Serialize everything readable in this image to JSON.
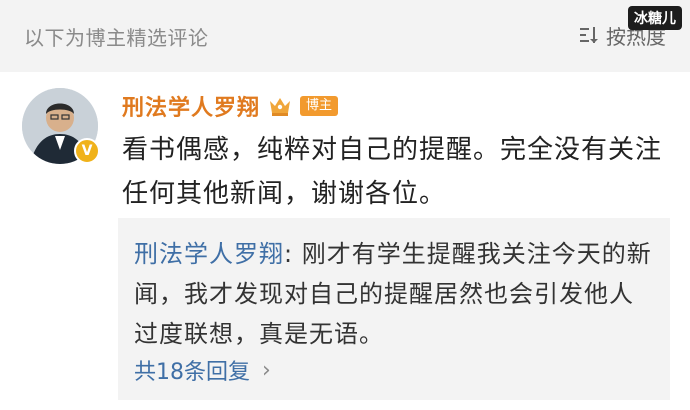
{
  "header": {
    "section_title": "以下为博主精选评论",
    "sort_label": "按热度",
    "watermark": "冰糖儿"
  },
  "comment": {
    "username": "刑法学人罗翔",
    "role_badge": "博主",
    "verified_badge": "V",
    "text": "看书偶感，纯粹对自己的提醒。完全没有关注任何其他新闻，谢谢各位。",
    "reply": {
      "author": "刑法学人罗翔",
      "text": ": 刚才有学生提醒我关注今天的新闻，我才发现对自己的提醒居然也会引发他人过度联想，真是无语。",
      "count_label": "共18条回复",
      "chevron": "›"
    }
  },
  "icons": {
    "sort": "sort-icon",
    "crown": "crown-icon",
    "chevron": "chevron-right-icon"
  },
  "colors": {
    "username": "#e07a1f",
    "reply_link": "#3f6fa6",
    "badge": "#f29a2e",
    "verified": "#f0b21a"
  }
}
